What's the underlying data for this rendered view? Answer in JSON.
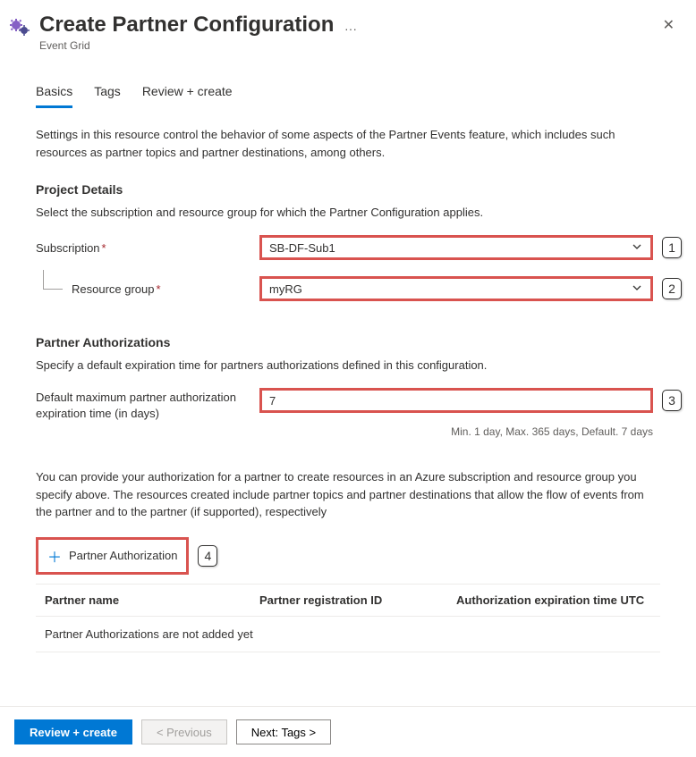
{
  "header": {
    "title": "Create Partner Configuration",
    "subtitle": "Event Grid"
  },
  "tabs": {
    "basics": "Basics",
    "tags": "Tags",
    "review": "Review + create"
  },
  "basics": {
    "intro": "Settings in this resource control the behavior of some aspects of the Partner Events feature, which includes such resources as partner topics and partner destinations, among others.",
    "project_heading": "Project Details",
    "project_desc": "Select the subscription and resource group for which the Partner Configuration applies.",
    "subscription_label": "Subscription",
    "subscription_value": "SB-DF-Sub1",
    "rg_label": "Resource group",
    "rg_value": "myRG",
    "auth_heading": "Partner Authorizations",
    "auth_desc": "Specify a default expiration time for partners authorizations defined in this configuration.",
    "expiry_label": "Default maximum partner authorization expiration time (in days)",
    "expiry_value": "7",
    "expiry_helper": "Min. 1 day, Max. 365 days, Default. 7 days",
    "auth_explain": "You can provide your authorization for a partner to create resources in an Azure subscription and resource group you specify above. The resources created include partner topics and partner destinations that allow the flow of events from the partner and to the partner (if supported), respectively",
    "add_auth_label": "Partner Authorization",
    "table": {
      "col_name": "Partner name",
      "col_reg": "Partner registration ID",
      "col_exp": "Authorization expiration time UTC",
      "empty": "Partner Authorizations are not added yet"
    }
  },
  "callouts": {
    "c1": "1",
    "c2": "2",
    "c3": "3",
    "c4": "4"
  },
  "footer": {
    "review": "Review + create",
    "previous": "< Previous",
    "next": "Next: Tags >"
  }
}
